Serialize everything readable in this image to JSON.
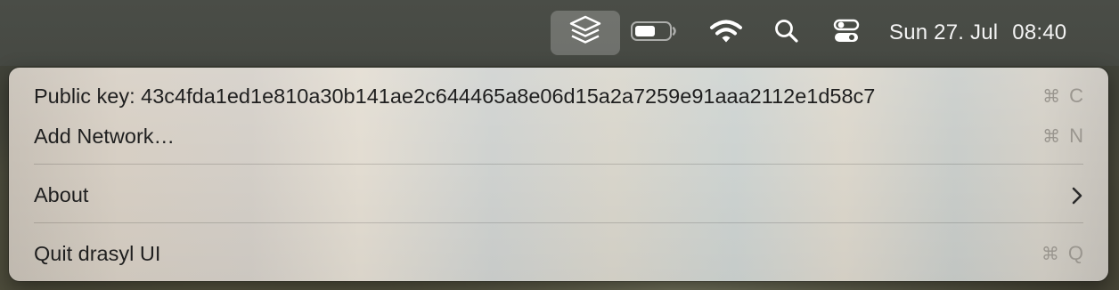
{
  "menubar": {
    "icons": {
      "app": "drasyl-layers-icon",
      "battery": "battery-icon",
      "wifi": "wifi-icon",
      "spotlight": "search-icon",
      "control_center": "control-center-icon"
    },
    "clock": {
      "date": "Sun 27. Jul",
      "time": "08:40"
    }
  },
  "menu": {
    "items": [
      {
        "label": "Public key: 43c4fda1ed1e810a30b141ae2c644465a8e06d15a2a7259e91aaa2112e1d58c7",
        "shortcut_symbol": "⌘",
        "shortcut_key": "C"
      },
      {
        "label": "Add Network…",
        "shortcut_symbol": "⌘",
        "shortcut_key": "N"
      },
      {
        "label": "About",
        "submenu_icon": "chevron-right-icon"
      },
      {
        "label": "Quit drasyl UI",
        "shortcut_symbol": "⌘",
        "shortcut_key": "Q"
      }
    ]
  }
}
